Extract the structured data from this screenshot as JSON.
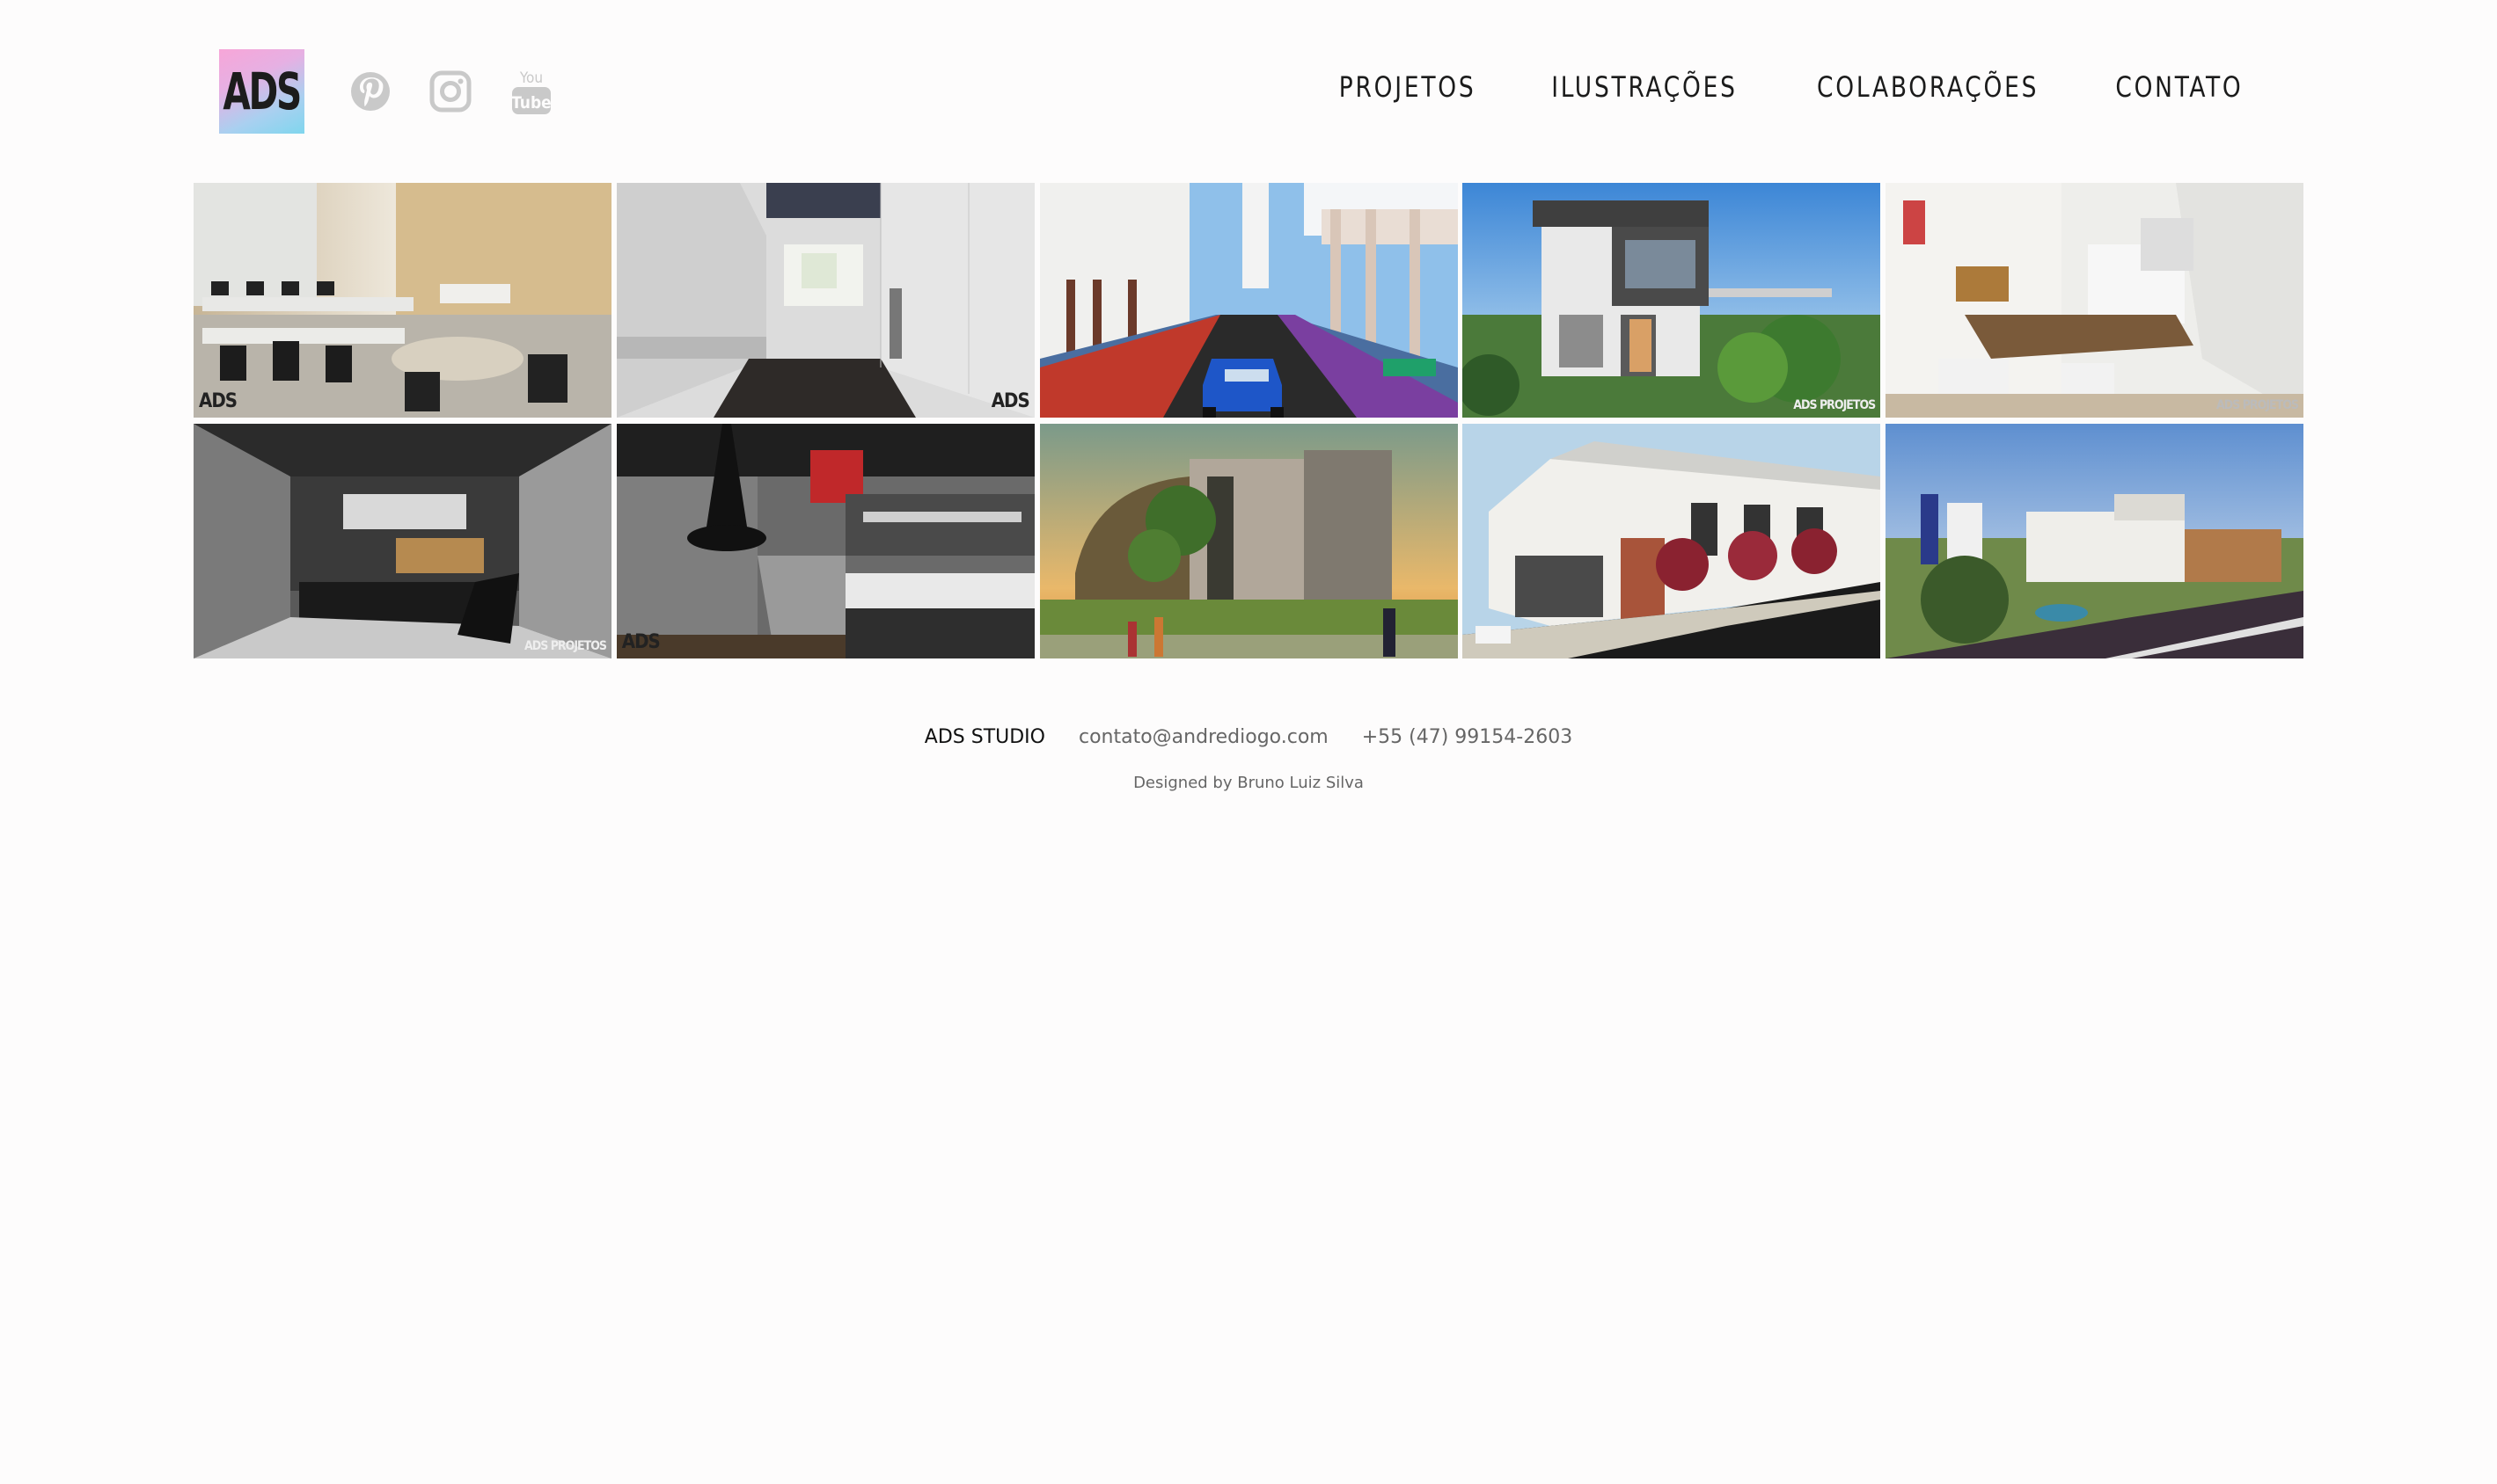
{
  "header": {
    "logo_text": "ADS",
    "social": [
      {
        "icon": "pinterest-icon"
      },
      {
        "icon": "instagram-icon"
      },
      {
        "icon": "youtube-icon",
        "label_top": "You",
        "label_bottom": "Tube"
      }
    ],
    "nav": [
      "PROJETOS",
      "ILUSTRAÇÕES",
      "COLABORAÇÕES",
      "CONTATO"
    ]
  },
  "gallery": {
    "watermarks": {
      "ads": "ADS",
      "ads_projetos": "ADS PROJETOS"
    }
  },
  "footer": {
    "brand": "ADS STUDIO",
    "email": "contato@andrediogo.com",
    "phone": "+55 (47) 99154-2603",
    "credit": "Designed by Bruno Luiz Silva"
  },
  "colors": {
    "background": "#fdfcfc",
    "nav_text": "#1b1b1b",
    "icon_gray": "#c9c9c9",
    "footer_text": "#666666"
  }
}
